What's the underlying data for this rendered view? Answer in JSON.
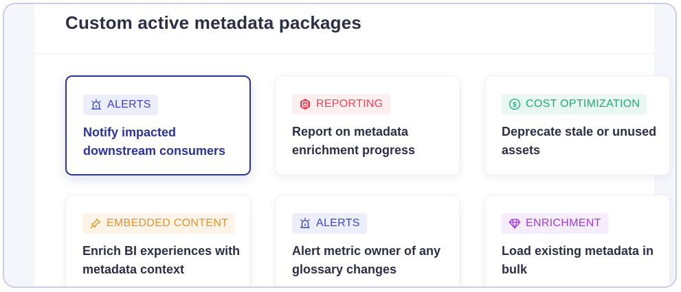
{
  "section": {
    "title": "Custom active metadata packages"
  },
  "cards": [
    {
      "tag": "ALERTS",
      "icon": "alarm-icon",
      "tag_color": "#3b43b8",
      "tag_bg": "#edeefc",
      "text": "Notify impacted downstream consumers",
      "selected": true
    },
    {
      "tag": "REPORTING",
      "icon": "report-icon",
      "tag_color": "#e2475a",
      "tag_bg": "#fdeef0",
      "text": "Report on metadata enrichment progress",
      "selected": false
    },
    {
      "tag": "COST OPTIMIZATION",
      "icon": "dollar-icon",
      "tag_color": "#1fa97c",
      "tag_bg": "#e8f8f1",
      "text": "Deprecate stale or unused assets",
      "selected": false
    },
    {
      "tag": "EMBEDDED CONTENT",
      "icon": "embed-icon",
      "tag_color": "#e0952f",
      "tag_bg": "#fdf3e6",
      "text": "Enrich BI experiences with metadata context",
      "selected": false
    },
    {
      "tag": "ALERTS",
      "icon": "alarm-icon",
      "tag_color": "#3b43b8",
      "tag_bg": "#edeefc",
      "text": "Alert metric owner of any glossary changes",
      "selected": false
    },
    {
      "tag": "ENRICHMENT",
      "icon": "diamond-icon",
      "tag_color": "#a23bd6",
      "tag_bg": "#f6ecfc",
      "text": "Load existing metadata in bulk",
      "selected": false
    }
  ]
}
